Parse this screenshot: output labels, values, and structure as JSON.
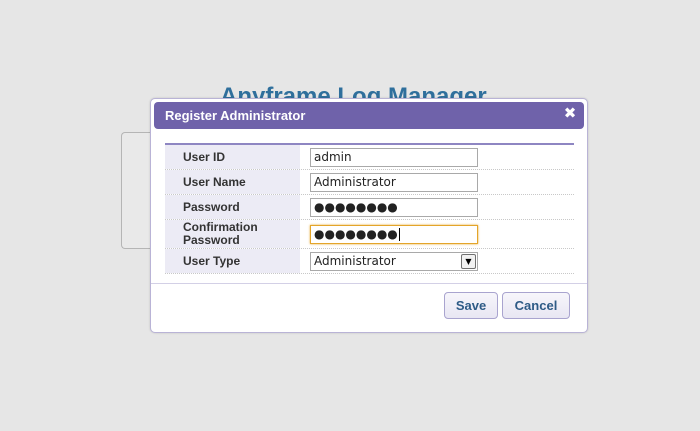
{
  "background": {
    "app_title": "Anyframe Log Manager"
  },
  "dialog": {
    "title": "Register Administrator",
    "close_glyph": "✖",
    "fields": {
      "user_id": {
        "label": "User ID",
        "value": "admin"
      },
      "user_name": {
        "label": "User Name",
        "value": "Administrator"
      },
      "password": {
        "label": "Password",
        "value": "●●●●●●●●"
      },
      "confirm_password": {
        "label_line1": "Confirmation",
        "label_line2": "Password",
        "value": "●●●●●●●●"
      },
      "user_type": {
        "label": "User Type",
        "selected": "Administrator"
      }
    },
    "buttons": {
      "save": "Save",
      "cancel": "Cancel"
    }
  },
  "colors": {
    "titlebar": "#6f62aa",
    "label_bg": "#ecebf5",
    "button_text": "#2e5b86",
    "focus_border": "#e4a52a"
  }
}
